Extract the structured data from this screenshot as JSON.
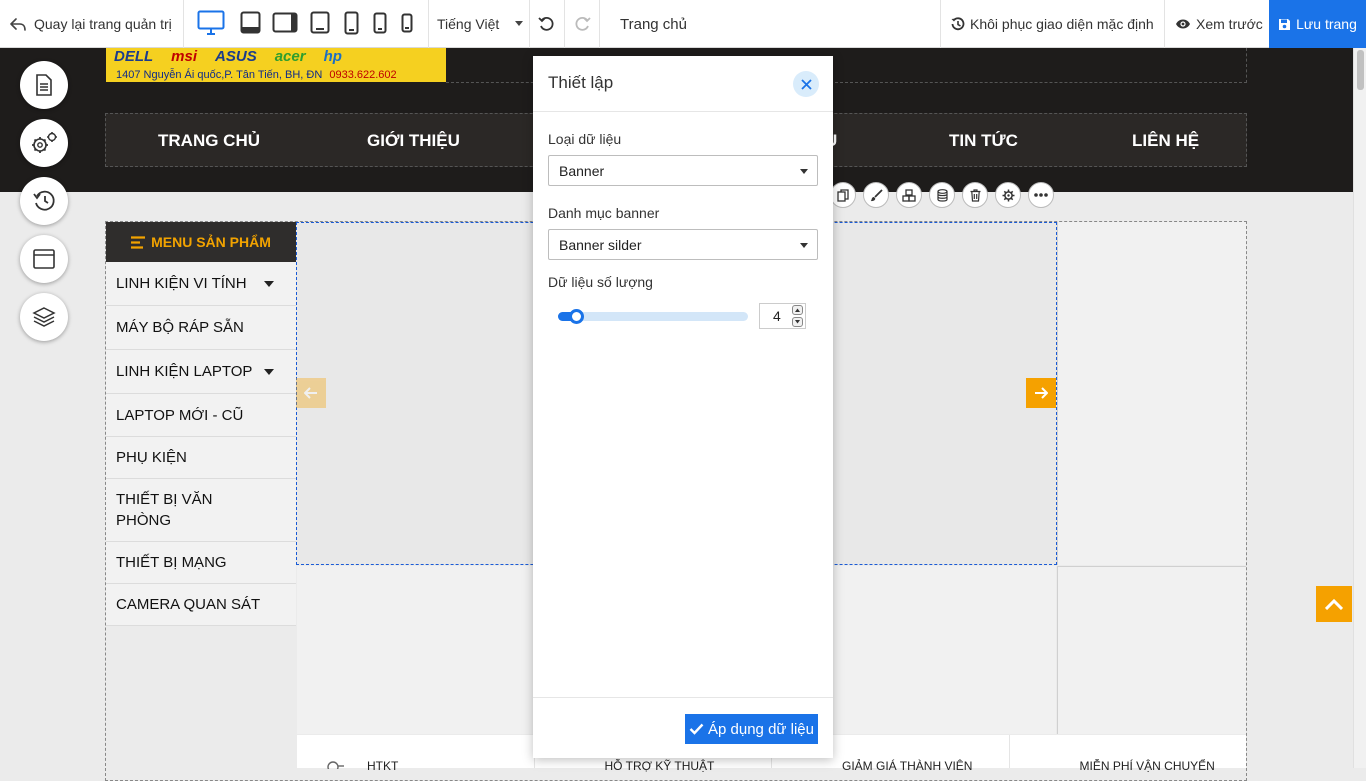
{
  "toolbar": {
    "back_label": "Quay lại trang quản trị",
    "language": "Tiếng Việt",
    "page_title": "Trang chủ",
    "restore_label": "Khôi phục giao diện mặc định",
    "preview_label": "Xem trước",
    "save_label": "Lưu trang",
    "active_device": "desktop",
    "accent_color": "#1a73e8"
  },
  "banner": {
    "logos": [
      "DELL",
      "msi",
      "ASUS",
      "acer",
      "hp"
    ],
    "address": "1407 Nguyễn Ái quốc,P. Tân Tiến, BH, ĐN",
    "phone": "0933.622.602"
  },
  "nav": {
    "items": [
      "TRANG CHỦ",
      "GIỚI THIỆU",
      "U",
      "TIN TỨC",
      "LIÊN HỆ"
    ]
  },
  "menu": {
    "header": "MENU SẢN PHẨM",
    "items": [
      {
        "label": "LINH KIỆN VI TÍNH",
        "has_sub": true
      },
      {
        "label": "MÁY BỘ RÁP SẴN",
        "has_sub": false
      },
      {
        "label": "LINH KIỆN LAPTOP",
        "has_sub": true
      },
      {
        "label": "LAPTOP MỚI - CŨ",
        "has_sub": false
      },
      {
        "label": "PHỤ KIỆN",
        "has_sub": false
      },
      {
        "label": "THIẾT BỊ VĂN PHÒNG",
        "has_sub": false
      },
      {
        "label": "THIẾT BỊ MẠNG",
        "has_sub": false
      },
      {
        "label": "CAMERA QUAN SÁT",
        "has_sub": false
      }
    ]
  },
  "features": [
    "HTKT",
    "HỖ TRỢ KỸ THUẬT",
    "GIẢM GIÁ THÀNH VIÊN",
    "MIỄN PHÍ VẬN CHUYỂN"
  ],
  "panel": {
    "title": "Thiết lập",
    "data_type_label": "Loại dữ liệu",
    "data_type_value": "Banner",
    "category_label": "Danh mục banner",
    "category_value": "Banner silder",
    "quantity_label": "Dữ liệu số lượng",
    "quantity_value": "4",
    "quantity_level": 0.06,
    "apply_label": "Áp dụng dữ liệu"
  }
}
